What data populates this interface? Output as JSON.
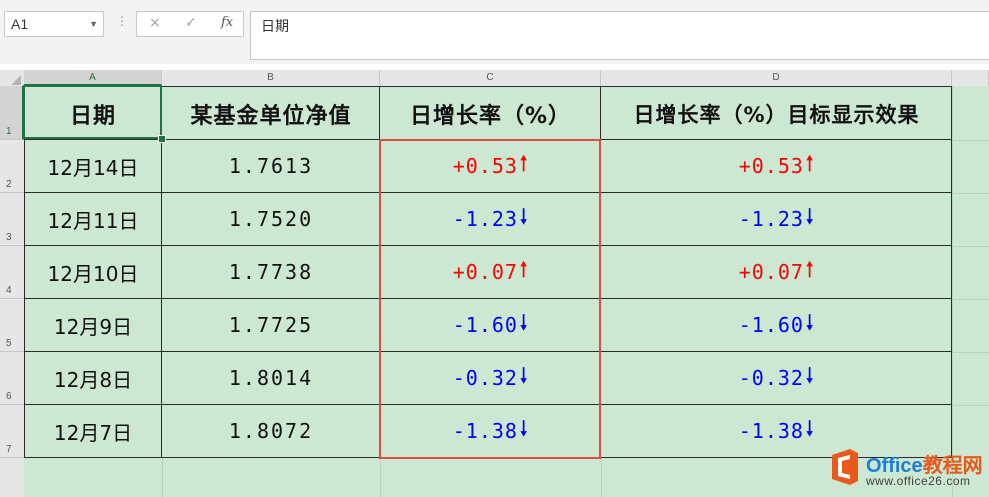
{
  "formula_bar": {
    "name_box": "A1",
    "cancel_icon": "×",
    "enter_icon": "✓",
    "fx_label": "fx",
    "content": "日期"
  },
  "columns": [
    "A",
    "B",
    "C",
    "D"
  ],
  "rows": [
    "1",
    "2",
    "3",
    "4",
    "5",
    "6",
    "7"
  ],
  "headers": [
    "日期",
    "某基金单位净值",
    "日增长率（%）",
    "日增长率（%）目标显示效果"
  ],
  "table": [
    {
      "date": "12月14日",
      "nav": "1.7613",
      "rate": "+0.53",
      "dir": "up",
      "arrow": "🠑",
      "target": "+0.53",
      "target_arrow": "🠑"
    },
    {
      "date": "12月11日",
      "nav": "1.7520",
      "rate": "-1.23",
      "dir": "down",
      "arrow": "🠓",
      "target": "-1.23",
      "target_arrow": "🠓"
    },
    {
      "date": "12月10日",
      "nav": "1.7738",
      "rate": "+0.07",
      "dir": "up",
      "arrow": "🠑",
      "target": "+0.07",
      "target_arrow": "🠑"
    },
    {
      "date": "12月9日",
      "nav": "1.7725",
      "rate": "-1.60",
      "dir": "down",
      "arrow": "🠓",
      "target": "-1.60",
      "target_arrow": "🠓"
    },
    {
      "date": "12月8日",
      "nav": "1.8014",
      "rate": "-0.32",
      "dir": "down",
      "arrow": "🠓",
      "target": "-0.32",
      "target_arrow": "🠓"
    },
    {
      "date": "12月7日",
      "nav": "1.8072",
      "rate": "-1.38",
      "dir": "down",
      "arrow": "🠓",
      "target": "-1.38",
      "target_arrow": "🠓"
    }
  ],
  "colors": {
    "up": "#ff0000",
    "down": "#0000ff",
    "sheet_fill": "#cde8d2",
    "highlight_border": "#e34a42",
    "selection": "#217346"
  },
  "watermark": {
    "brand": "Office",
    "brand_cn": "教程网",
    "url": "www.office26.com"
  }
}
